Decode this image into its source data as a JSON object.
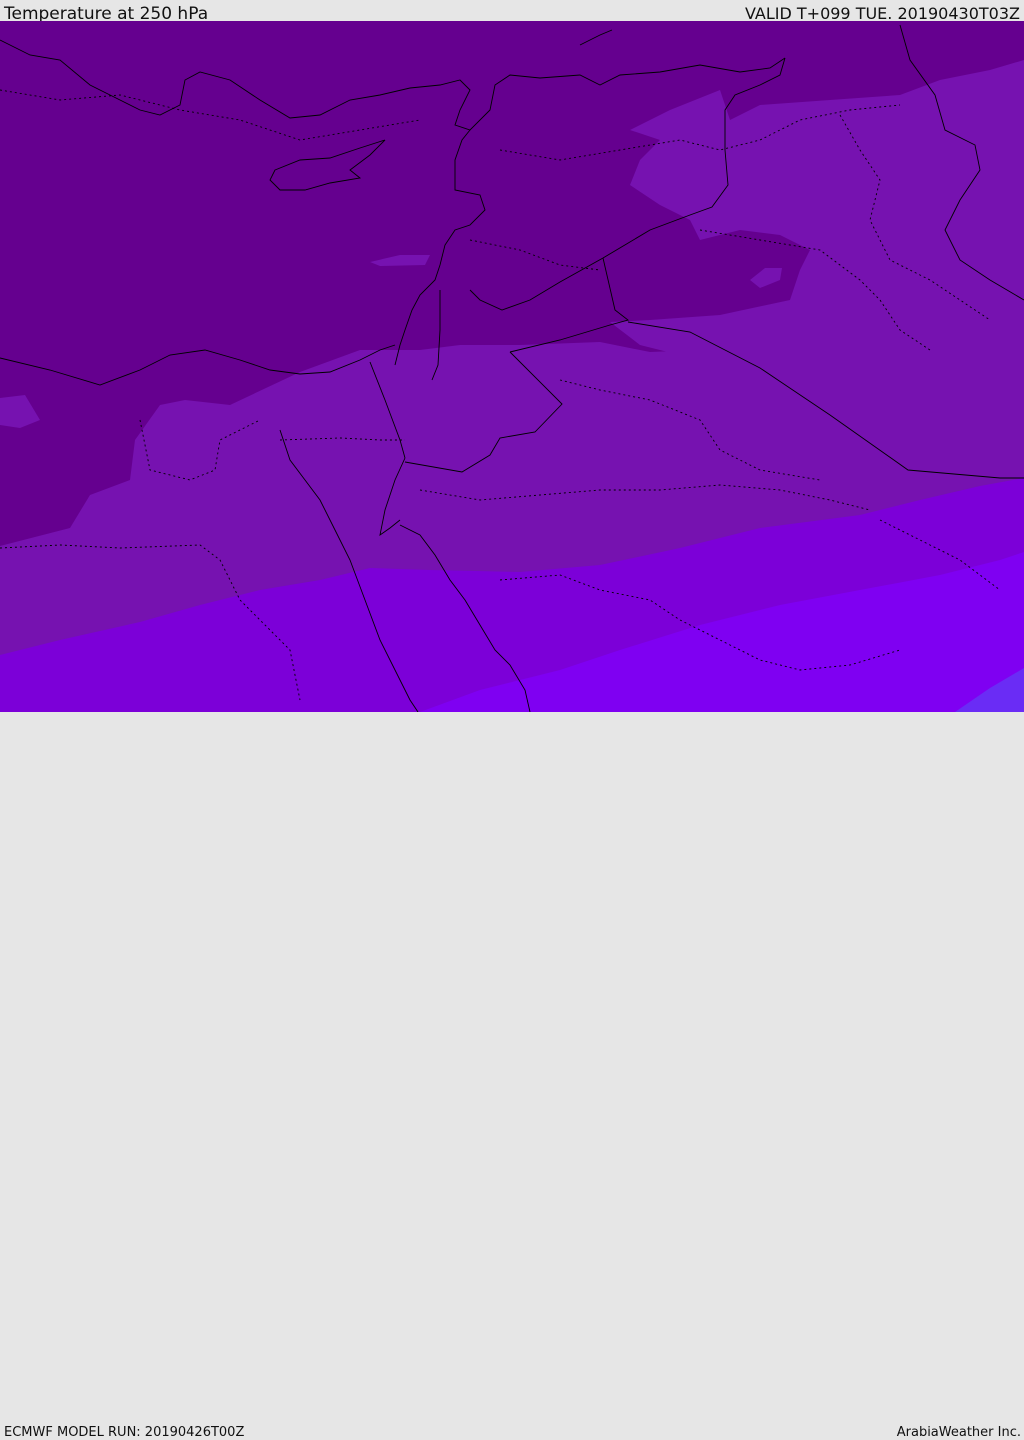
{
  "header": {
    "title": "Temperature at 250 hPa",
    "valid": "VALID T+099 TUE. 20190430T03Z"
  },
  "footer": {
    "model_run": "ECMWF MODEL RUN: 20190426T00Z",
    "credit": "ArabiaWeather Inc."
  },
  "colors": {
    "band_coldest": "#65008f",
    "band_cold": "#7612b0",
    "band_mid": "#7c00d8",
    "band_warm": "#7f00f2",
    "band_warmest": "#6a2cf5",
    "border_line": "#000000",
    "frame_bg": "#e6e6e6"
  }
}
